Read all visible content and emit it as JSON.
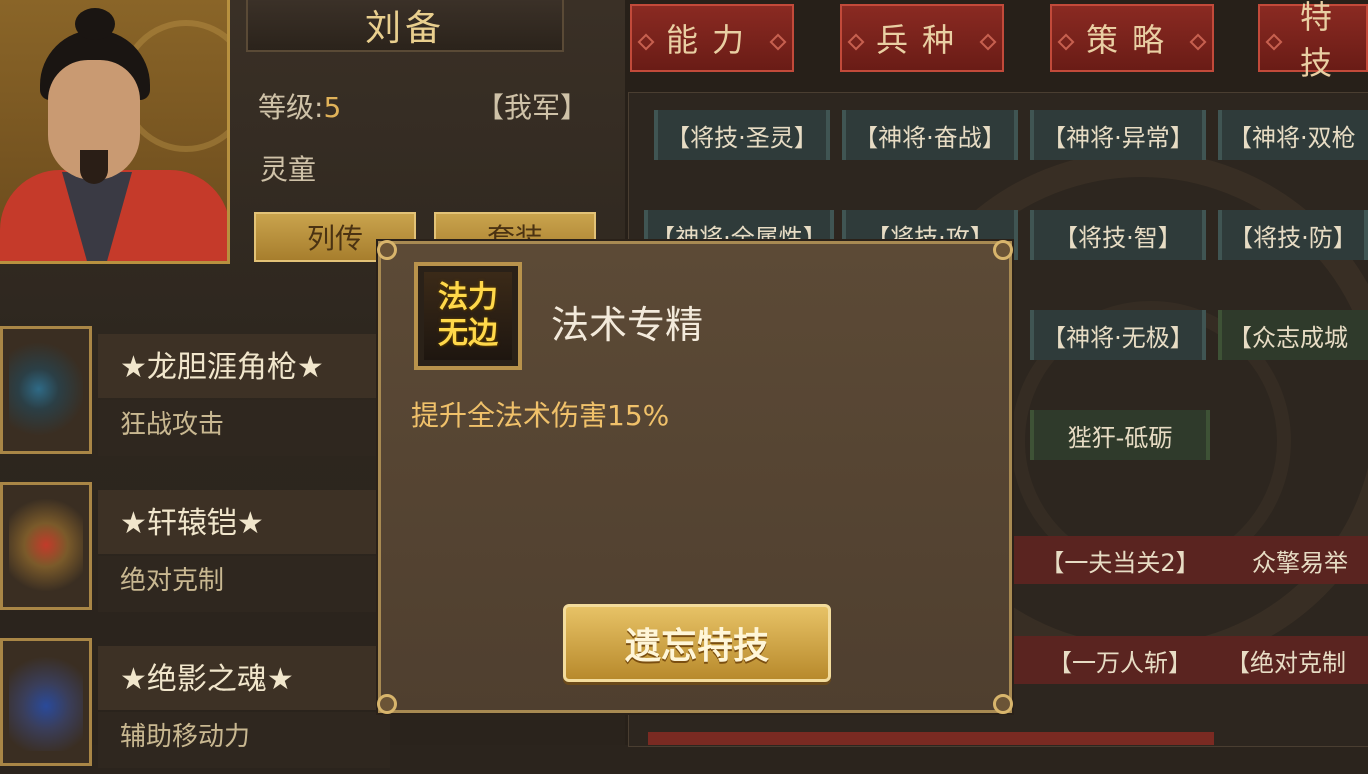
{
  "hero": {
    "name": "刘备",
    "level_label": "等级:",
    "level_value": "5",
    "faction": "【我军】",
    "class_name": "灵童"
  },
  "buttons": {
    "biography": "列传",
    "set": "套装",
    "forget_skill": "遗忘特技"
  },
  "equipment": [
    {
      "name": "★龙胆涯角枪★",
      "effect": "狂战攻击"
    },
    {
      "name": "★轩辕铠★",
      "effect": "绝对克制"
    },
    {
      "name": "★绝影之魂★",
      "effect": "辅助移动力"
    }
  ],
  "tabs": [
    "能力",
    "兵种",
    "策略",
    "特技"
  ],
  "skills": {
    "row1": [
      "【将技·圣灵】",
      "【神将·奋战】",
      "【神将·异常】",
      "【神将·双枪"
    ],
    "row2": [
      "【神将·全属性】",
      "【将技·攻】",
      "【将技·智】",
      "【将技·防】"
    ],
    "row3": [
      "【神将·无极】",
      "【众志成城"
    ],
    "row4": [
      "狴犴-砥砺"
    ],
    "row5": [
      "【一夫当关2】",
      "众擎易举"
    ],
    "row6": [
      "【一万人斩】",
      "【绝对克制"
    ]
  },
  "popup": {
    "icon_text_1": "法力",
    "icon_text_2": "无边",
    "skill_name": "法术专精",
    "skill_desc": "提升全法术伤害15%"
  },
  "colors": {
    "accent_gold": "#c9a34d",
    "tab_red": "#8a2a22",
    "desc_orange": "#f0c16a"
  }
}
